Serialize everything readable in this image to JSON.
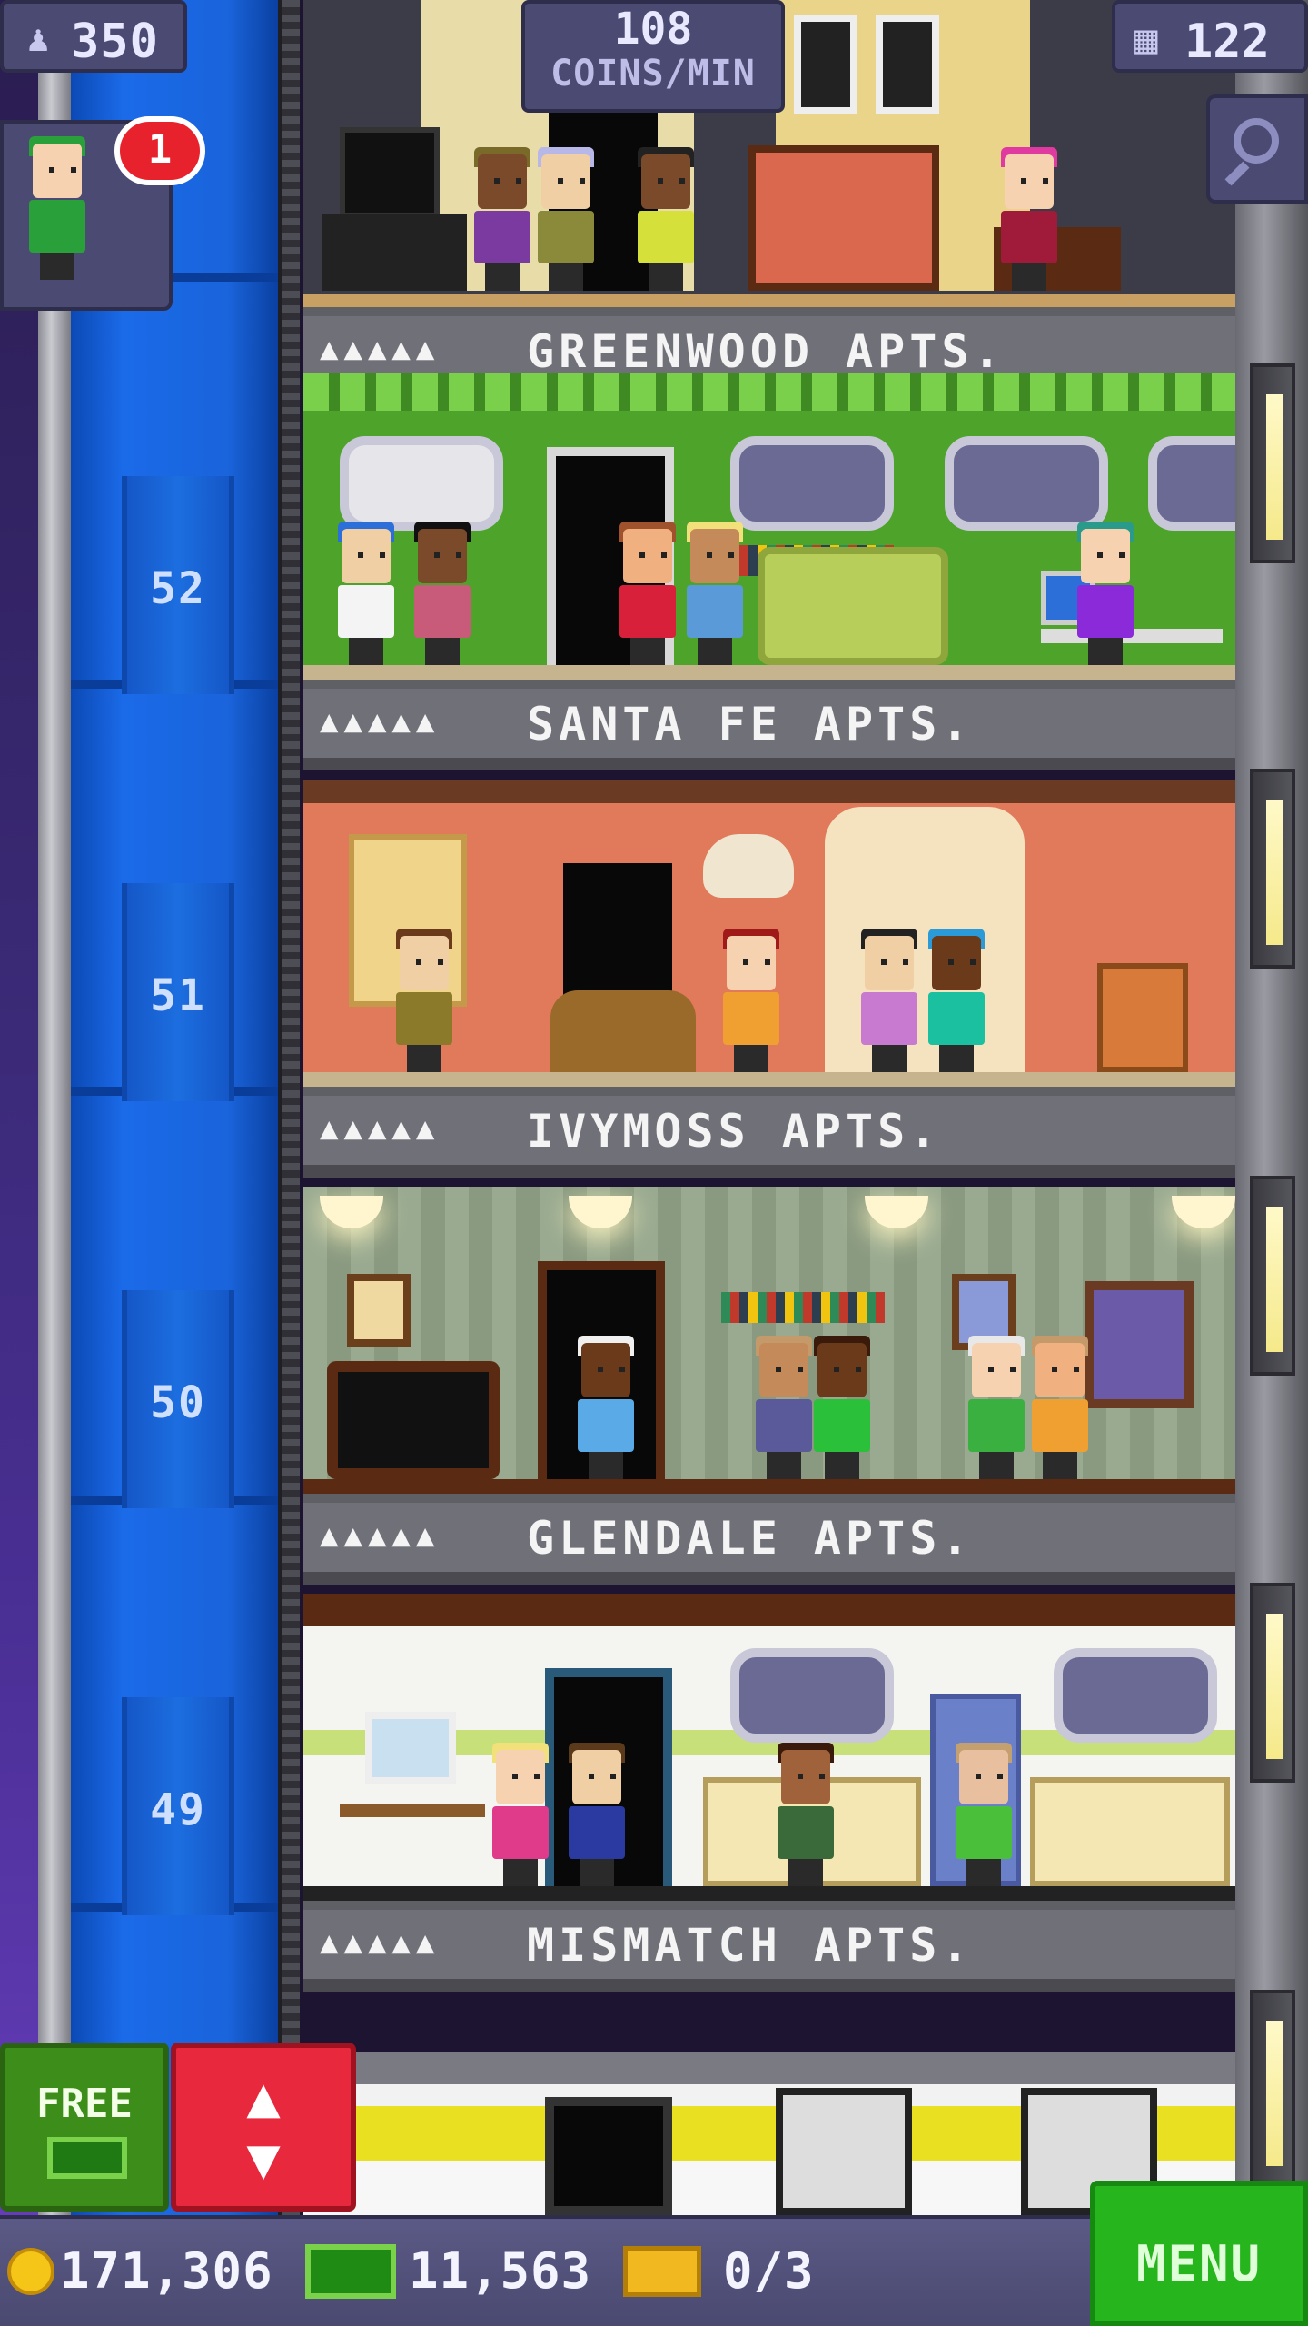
{
  "hud": {
    "population": "350",
    "coins_per_min_value": "108",
    "coins_per_min_label": "COINS/MIN",
    "floor_count": "122",
    "visitor_badge": "1",
    "free_button_label": "FREE"
  },
  "shaft": {
    "floors": [
      "52",
      "51",
      "50",
      "49"
    ]
  },
  "floors": [
    {
      "name": "GREENWOOD APTS.",
      "dots": "▲▲▲▲▲"
    },
    {
      "name": "SANTA FE APTS.",
      "dots": "▲▲▲▲▲"
    },
    {
      "name": "IVYMOSS APTS.",
      "dots": "▲▲▲▲▲"
    },
    {
      "name": "GLENDALE APTS.",
      "dots": "▲▲▲▲▲"
    },
    {
      "name": "MISMATCH APTS.",
      "dots": "▲▲▲▲▲"
    }
  ],
  "bottom_bar": {
    "coins": "171,306",
    "bux": "11,563",
    "tickets": "0/3",
    "menu_label": "MENU"
  },
  "icons": {
    "population": "person-icon",
    "floors": "building-icon",
    "search": "magnifier-icon",
    "coin": "coin-icon",
    "bux": "tower-bux-icon",
    "ticket": "golden-ticket-icon",
    "elevator": "elevator-arrows-icon"
  },
  "colors": {
    "shaft_blue": "#1b6ae8",
    "hud_purple": "#4b4a73",
    "menu_green": "#27b51e",
    "elevator_red": "#e8283c"
  }
}
